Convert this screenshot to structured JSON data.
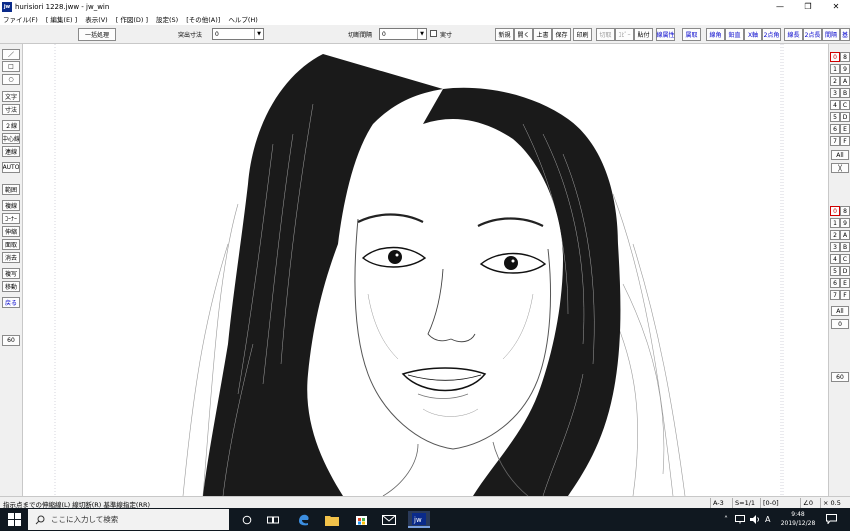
{
  "window": {
    "app_icon": "jw",
    "title": "hurisiori 1228.jww - jw_win",
    "minimize": "—",
    "maximize": "❐",
    "close": "✕"
  },
  "menu": [
    "ファイル(F)",
    "[ 編集(E) ]",
    "表示(V)",
    "[ 作図(D) ]",
    "設定(S)",
    "[その他(A)]",
    "ヘルプ(H)"
  ],
  "toolbar": {
    "batch": "一括処理",
    "protrude_label": "突出寸法",
    "protrude_value": "0",
    "gap_label": "切断間隔",
    "gap_value": "0",
    "actual_label": "実寸",
    "file_buttons": [
      "新規",
      "開く",
      "上書",
      "保存",
      "印刷"
    ],
    "edit_buttons": [
      "切取",
      "ｺﾋﾟｰ",
      "貼付"
    ],
    "extra_buttons": [
      "線属性",
      "属取",
      "線角",
      "鉛直",
      "X軸",
      "2点角",
      "線長",
      "2点長",
      "間隔",
      "基"
    ]
  },
  "left_tools": [
    "／",
    "□",
    "○",
    "文字",
    "寸法",
    "２線",
    "中心線",
    "連線",
    "AUTO",
    "範囲",
    "複線",
    "ｺｰﾅｰ",
    "伸縮",
    "面取",
    "消去",
    "複写",
    "移動",
    "戻る",
    "60"
  ],
  "right_layers": {
    "groups_top": [
      [
        "0",
        "8"
      ],
      [
        "1",
        "9"
      ],
      [
        "2",
        "A"
      ],
      [
        "3",
        "B"
      ],
      [
        "4",
        "C"
      ],
      [
        "5",
        "D"
      ],
      [
        "6",
        "E"
      ],
      [
        "7",
        "F"
      ]
    ],
    "all_label": "All",
    "x_label": "╳",
    "groups_bottom": [
      [
        "0",
        "8"
      ],
      [
        "1",
        "9"
      ],
      [
        "2",
        "A"
      ],
      [
        "3",
        "B"
      ],
      [
        "4",
        "C"
      ],
      [
        "5",
        "D"
      ],
      [
        "6",
        "E"
      ],
      [
        "7",
        "F"
      ]
    ],
    "all_label_2": "All",
    "zero_label": "0",
    "scale": "60"
  },
  "status": {
    "message": "指示点までの伸縮線(L) 線切断(R) 基準線指定(RR)",
    "paper": "A-3",
    "scale": "S=1/1",
    "layer": "[0-0]",
    "angle": "∠0",
    "zoom": "× 0.5"
  },
  "taskbar": {
    "search_placeholder": "ここに入力して検索",
    "ime": "A",
    "time": "9:48",
    "date": "2019/12/28"
  }
}
